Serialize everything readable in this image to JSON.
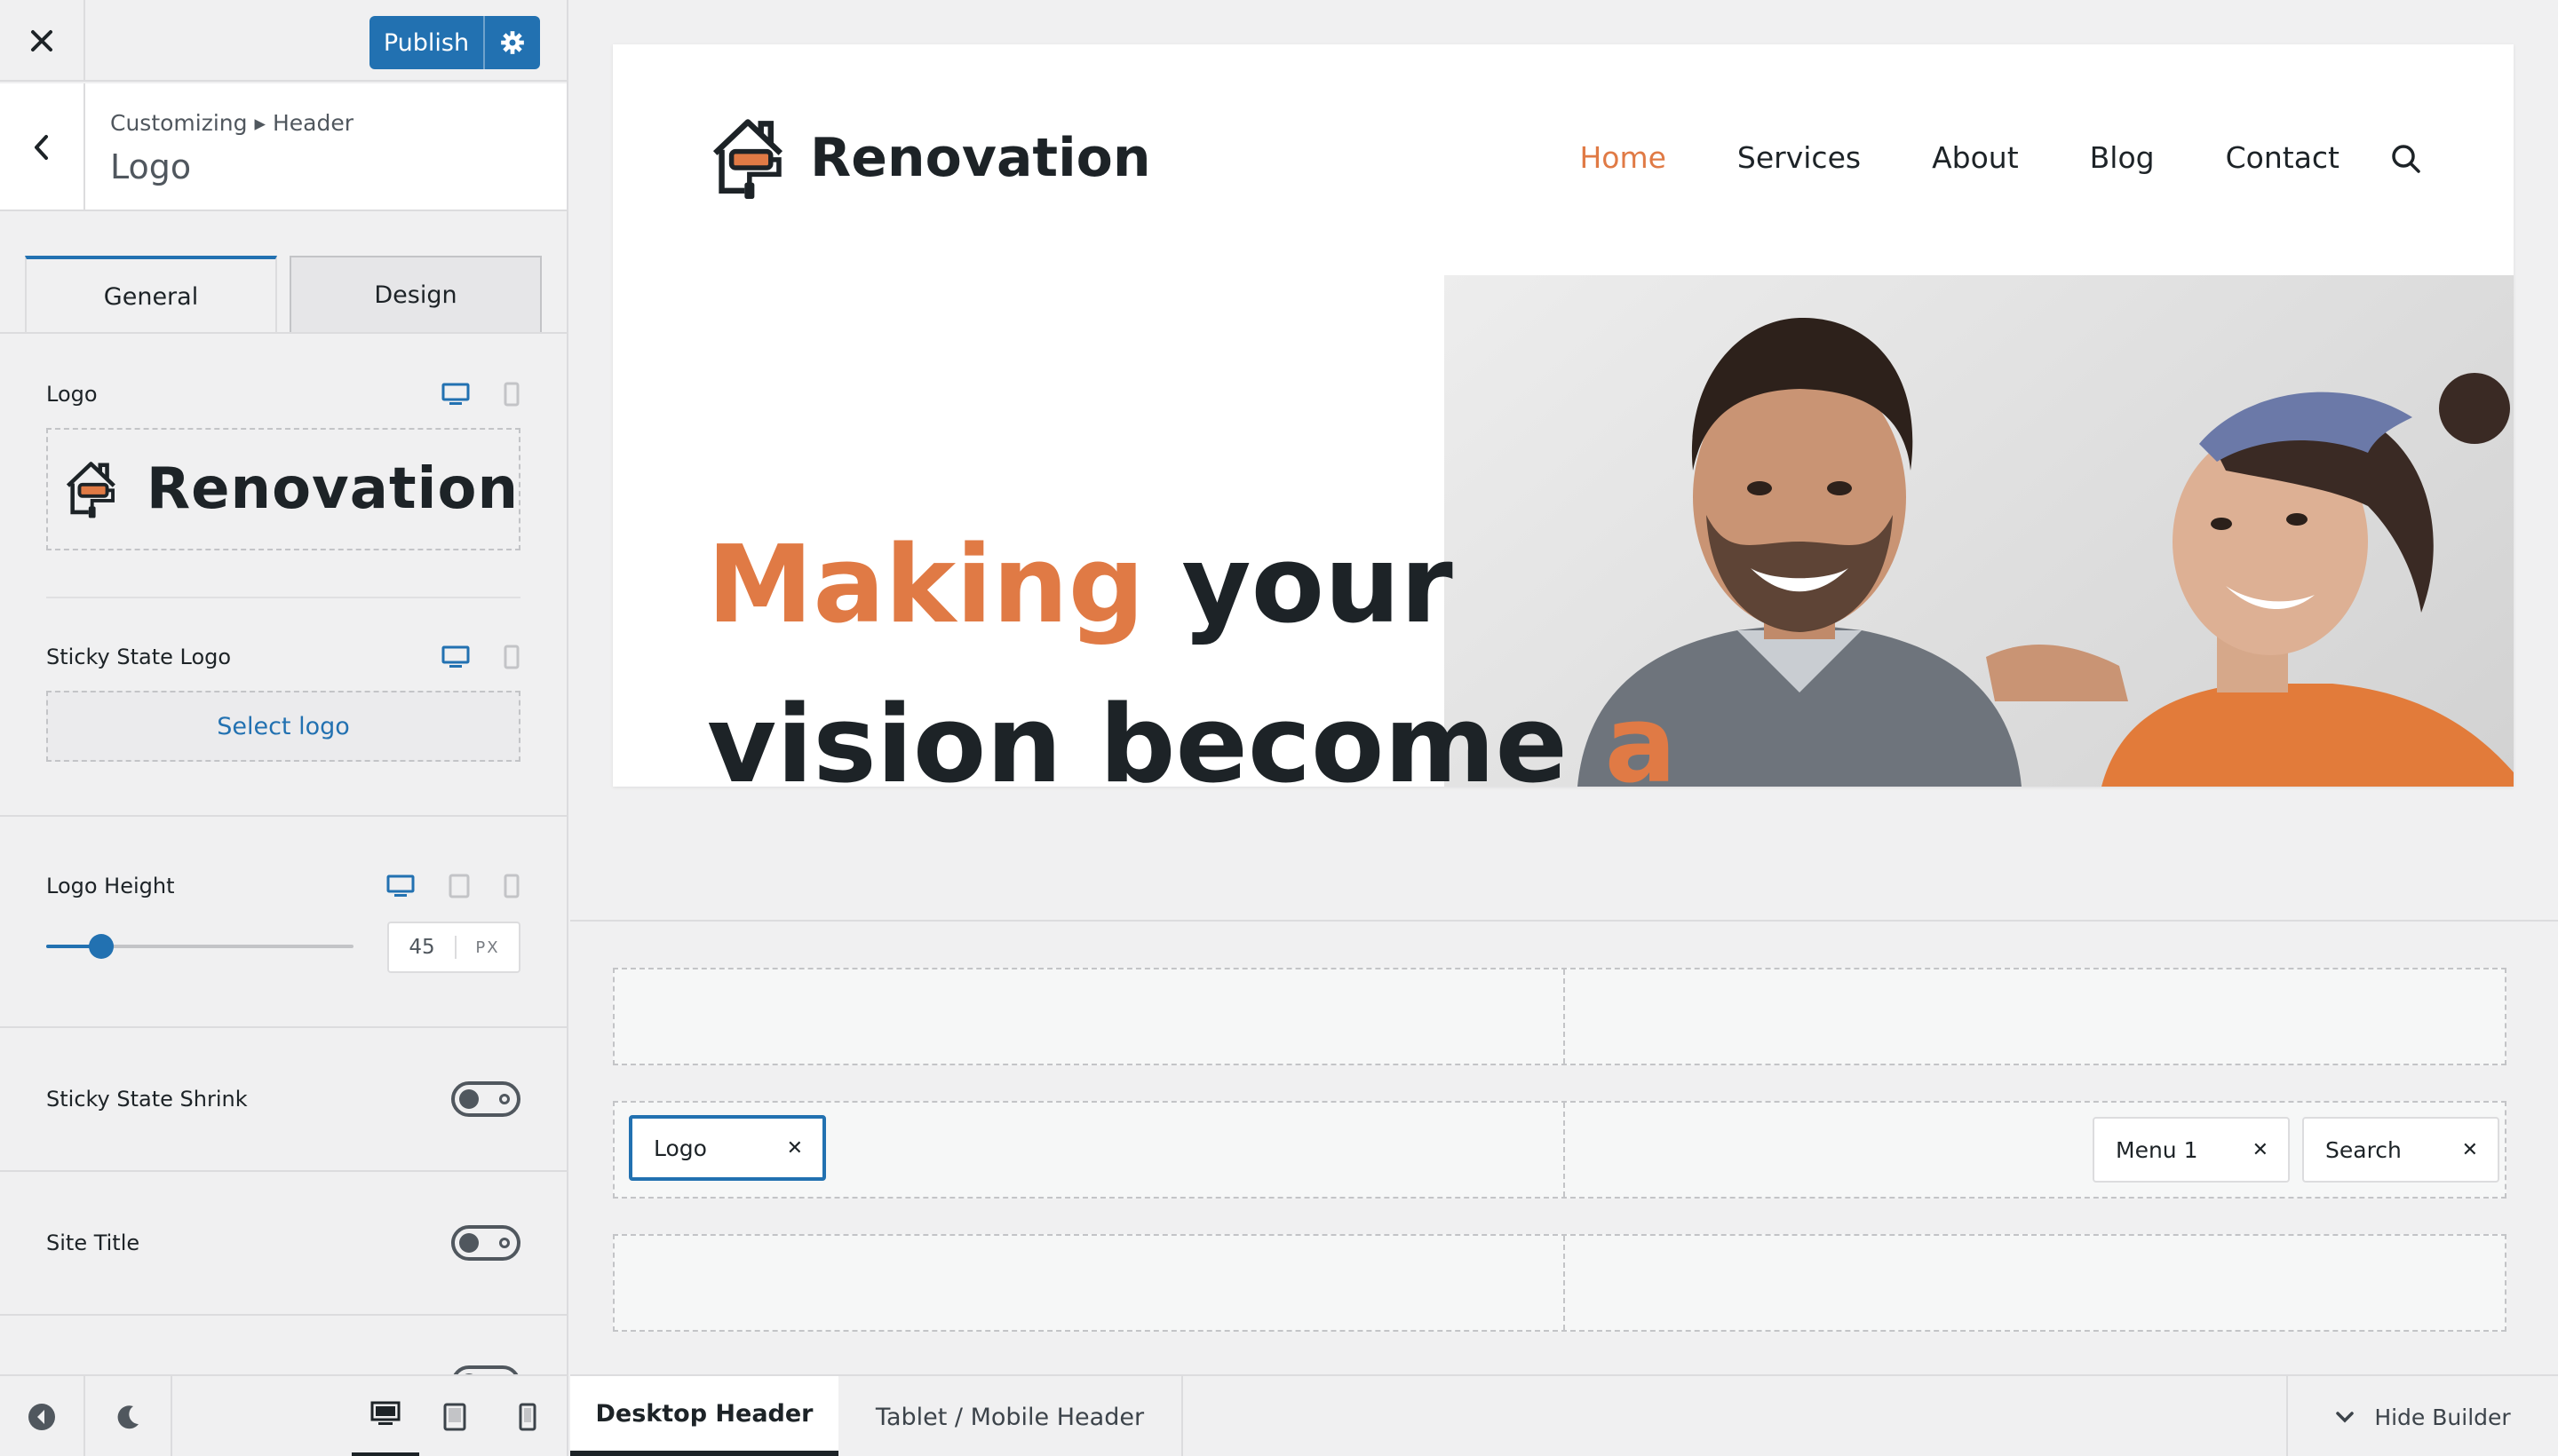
{
  "topbar": {
    "publish_label": "Publish"
  },
  "section": {
    "breadcrumb": "Customizing ▸ Header",
    "title": "Logo"
  },
  "tabs": [
    {
      "label": "General",
      "active": true
    },
    {
      "label": "Design",
      "active": false
    }
  ],
  "options": {
    "logo": {
      "label": "Logo",
      "text": "Renovation"
    },
    "sticky_logo": {
      "label": "Sticky State Logo",
      "button": "Select logo"
    },
    "logo_height": {
      "label": "Logo Height",
      "value": "45",
      "unit": "PX",
      "slider_fraction": 0.18
    },
    "sticky_shrink": {
      "label": "Sticky State Shrink",
      "enabled": false
    },
    "site_title": {
      "label": "Site Title",
      "enabled": false
    }
  },
  "preview": {
    "site_name": "Renovation",
    "nav": [
      {
        "label": "Home",
        "active": true
      },
      {
        "label": "Services",
        "active": false
      },
      {
        "label": "About",
        "active": false
      },
      {
        "label": "Blog",
        "active": false
      },
      {
        "label": "Contact",
        "active": false
      }
    ],
    "hero": {
      "accent1": "Making",
      "line1_rest": " your",
      "line2": "vision become ",
      "accent2": "a"
    }
  },
  "builder": {
    "chips": [
      {
        "label": "Logo"
      },
      {
        "label": "Menu 1"
      },
      {
        "label": "Search"
      }
    ],
    "remove_glyph": "✕",
    "tabs": [
      {
        "label": "Desktop Header",
        "active": true
      },
      {
        "label": "Tablet / Mobile Header",
        "active": false
      }
    ],
    "hide_label": "Hide Builder"
  },
  "colors": {
    "accent": "#2271b1",
    "brand_orange": "#e07a45",
    "text_dark": "#1d2327"
  }
}
